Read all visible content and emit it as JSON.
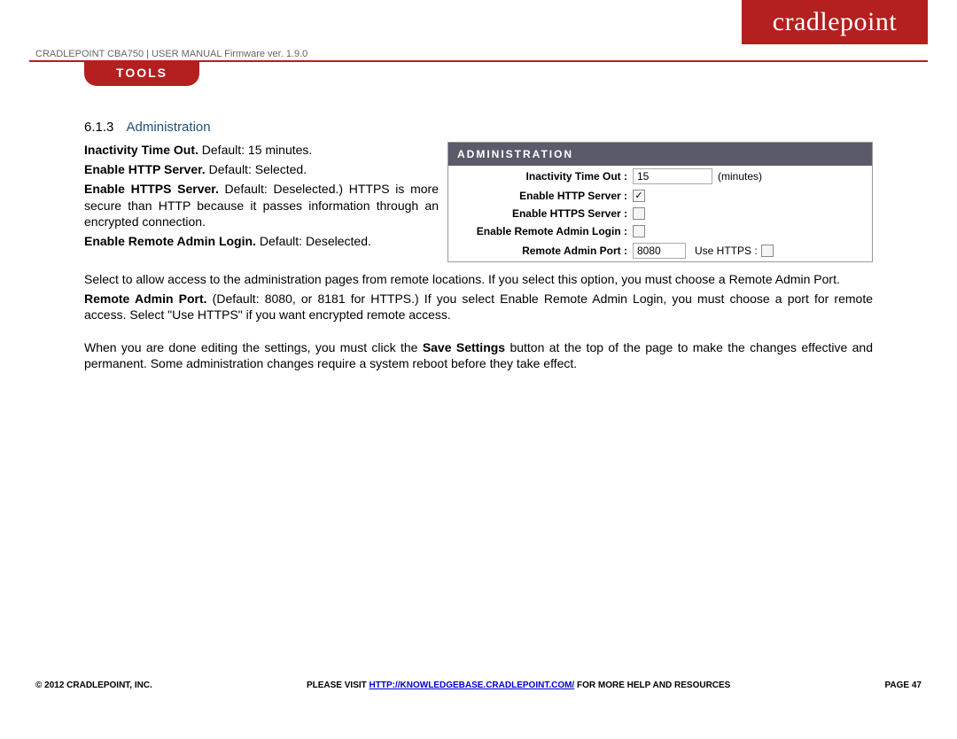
{
  "logo": "cradlepoint",
  "header": "CRADLEPOINT CBA750 | USER MANUAL Firmware ver. 1.9.0",
  "pill": "TOOLS",
  "section": {
    "num": "6.1.3",
    "title": "Administration"
  },
  "body": {
    "p1_bold": "Inactivity Time Out.",
    "p1_rest": " Default: 15 minutes.",
    "p2_bold": "Enable HTTP Server.",
    "p2_rest": " Default: Selected.",
    "p3_bold": "Enable HTTPS Server.",
    "p3_rest": " Default: Deselected.) HTTPS is more secure than HTTP because it passes information through an encrypted connection.",
    "p4_bold": "Enable Remote Admin Login.",
    "p4_rest": " Default: Deselected.",
    "p4b": "Select to allow access to the administration pages from remote locations. If you select this option, you must choose a Remote Admin Port.",
    "p5_bold": "Remote Admin Port.",
    "p5_rest": " (Default: 8080, or 8181 for HTTPS.) If you select Enable Remote Admin Login, you must choose a port for remote access. Select \"Use HTTPS\" if you want encrypted remote access.",
    "p6a": "When you are done editing the settings, you must click the ",
    "p6_bold": "Save Settings",
    "p6b": " button at the top of the page to make the changes effective and permanent. Some administration changes require a system reboot before they take effect."
  },
  "panel": {
    "header": "Administration",
    "rows": {
      "inactivity": {
        "label": "Inactivity Time Out :",
        "value": "15",
        "unit": "(minutes)"
      },
      "http": {
        "label": "Enable HTTP Server :",
        "checked": true
      },
      "https": {
        "label": "Enable HTTPS Server :",
        "checked": false
      },
      "remote": {
        "label": "Enable Remote Admin Login :",
        "checked": false
      },
      "port": {
        "label": "Remote Admin Port :",
        "value": "8080",
        "use_https_label": "Use HTTPS :",
        "use_https_checked": false
      }
    }
  },
  "footer": {
    "left": "© 2012 CRADLEPOINT, INC.",
    "mid_pre": "PLEASE VISIT ",
    "mid_link": "HTTP://KNOWLEDGEBASE.CRADLEPOINT.COM/",
    "mid_post": " FOR MORE HELP AND RESOURCES",
    "right": "PAGE 47"
  }
}
